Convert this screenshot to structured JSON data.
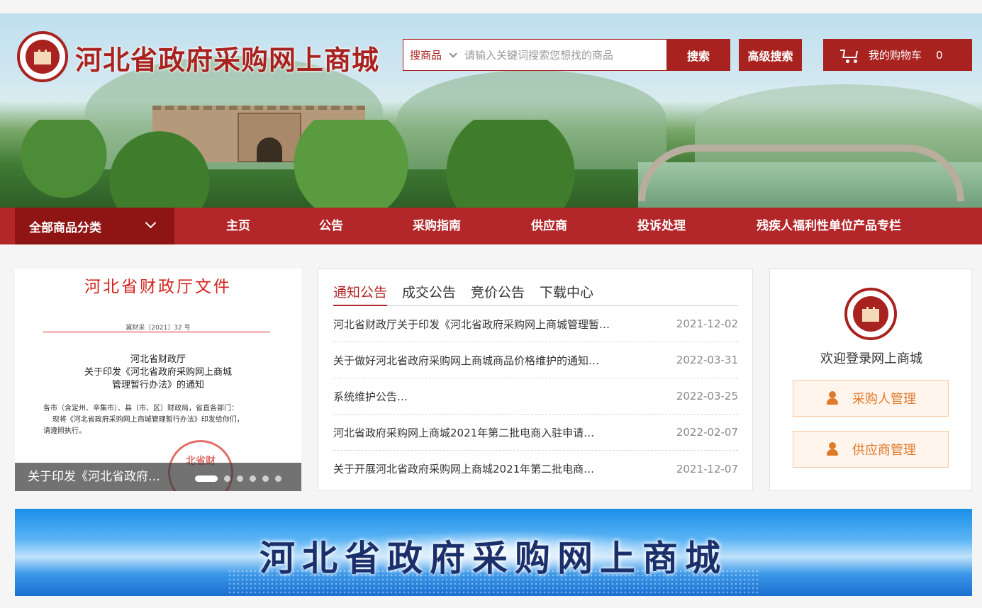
{
  "header": {
    "site_title": "河北省政府采购网上商城",
    "search": {
      "scope_label": "搜商品",
      "placeholder": "请输入关键词搜索您想找的商品",
      "value": "",
      "search_label": "搜索",
      "advanced_label": "高级搜索"
    },
    "cart": {
      "label": "我的购物车",
      "count": "0"
    }
  },
  "nav": {
    "category_label": "全部商品分类",
    "items": [
      {
        "label": "主页"
      },
      {
        "label": "公告"
      },
      {
        "label": "采购指南"
      },
      {
        "label": "供应商"
      },
      {
        "label": "投诉处理"
      },
      {
        "label": "残疾人福利性单位产品专栏"
      }
    ]
  },
  "slider": {
    "doc_header": "河北省财政厅文件",
    "doc_number": "冀财采〔2021〕32 号",
    "doc_title_lines": [
      "河北省财政厅",
      "关于印发《河北省政府采购网上商城",
      "管理暂行办法》的通知"
    ],
    "doc_body_lines": [
      "各市（含定州、辛集市）、县（市、区）财政局，省直各部门：",
      "    现将《河北省政府采购网上商城管理暂行办法》印发给你们，",
      "请遵照执行。"
    ],
    "seal_text": "北省财",
    "caption": "关于印发《河北省政府…",
    "slide_count": 6,
    "active_slide": 1
  },
  "notices": {
    "tabs": [
      {
        "label": "通知公告",
        "active": true
      },
      {
        "label": "成交公告",
        "active": false
      },
      {
        "label": "竞价公告",
        "active": false
      },
      {
        "label": "下载中心",
        "active": false
      }
    ],
    "items": [
      {
        "title": "河北省财政厅关于印发《河北省政府采购网上商城管理暂…",
        "date": "2021-12-02"
      },
      {
        "title": "关于做好河北省政府采购网上商城商品价格维护的通知…",
        "date": "2022-03-31"
      },
      {
        "title": "系统维护公告…",
        "date": "2022-03-25"
      },
      {
        "title": "河北省政府采购网上商城2021年第二批电商入驻申请…",
        "date": "2022-02-07"
      },
      {
        "title": "关于开展河北省政府采购网上商城2021年第二批电商…",
        "date": "2021-12-07"
      }
    ]
  },
  "login": {
    "welcome": "欢迎登录网上商城",
    "buyer_label": "采购人管理",
    "supplier_label": "供应商管理"
  },
  "bottom_banner": {
    "title": "河北省政府采购网上商城"
  },
  "colors": {
    "brand_red": "#a8231f",
    "nav_red": "#b3272a",
    "accent_orange": "#e07a2b"
  }
}
